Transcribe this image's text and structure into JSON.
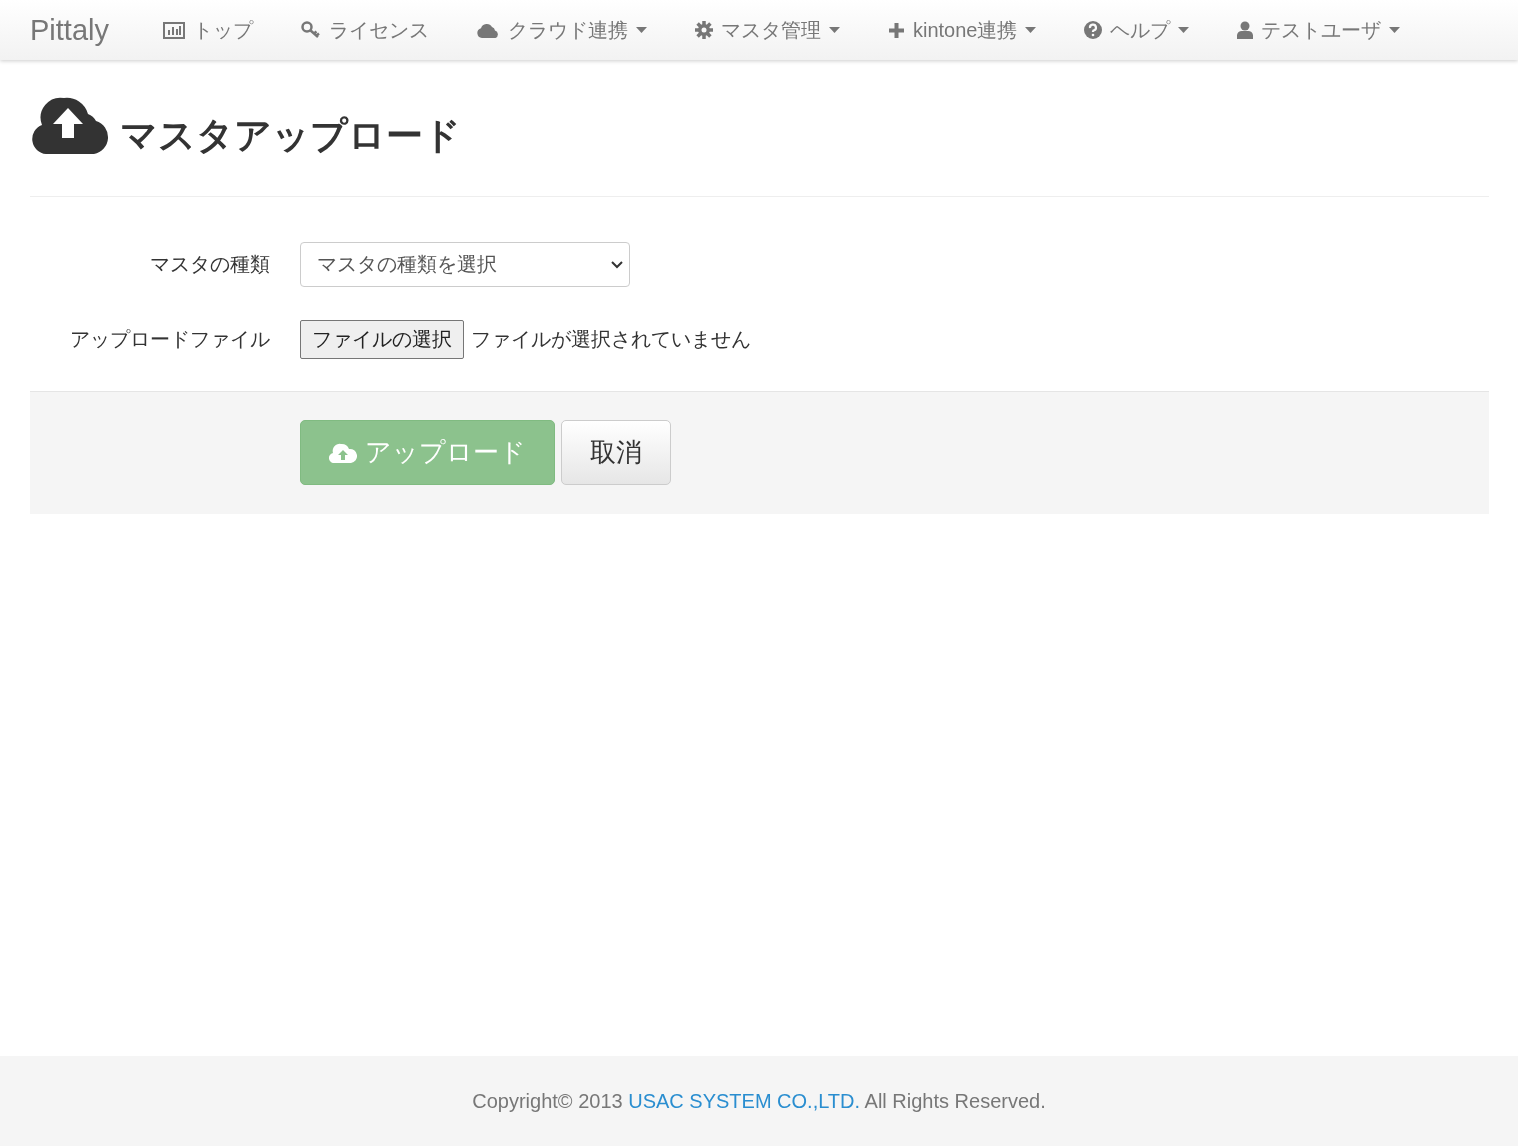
{
  "navbar": {
    "brand": "Pittaly",
    "items": [
      {
        "label": "トップ",
        "dropdown": false
      },
      {
        "label": "ライセンス",
        "dropdown": false
      },
      {
        "label": "クラウド連携",
        "dropdown": true
      },
      {
        "label": "マスタ管理",
        "dropdown": true
      },
      {
        "label": "kintone連携",
        "dropdown": true
      },
      {
        "label": "ヘルプ",
        "dropdown": true
      },
      {
        "label": "テストユーザ",
        "dropdown": true
      }
    ]
  },
  "page": {
    "title": "マスタアップロード"
  },
  "form": {
    "master_type": {
      "label": "マスタの種類",
      "placeholder": "マスタの種類を選択"
    },
    "upload_file": {
      "label": "アップロードファイル",
      "button": "ファイルの選択",
      "status": "ファイルが選択されていません"
    }
  },
  "actions": {
    "upload": {
      "label": "アップロード",
      "disabled": true
    },
    "cancel": {
      "label": "取消"
    }
  },
  "footer": {
    "prefix": "Copyright© 2013 ",
    "link": "USAC SYSTEM CO.,LTD.",
    "suffix": " All Rights Reserved."
  }
}
